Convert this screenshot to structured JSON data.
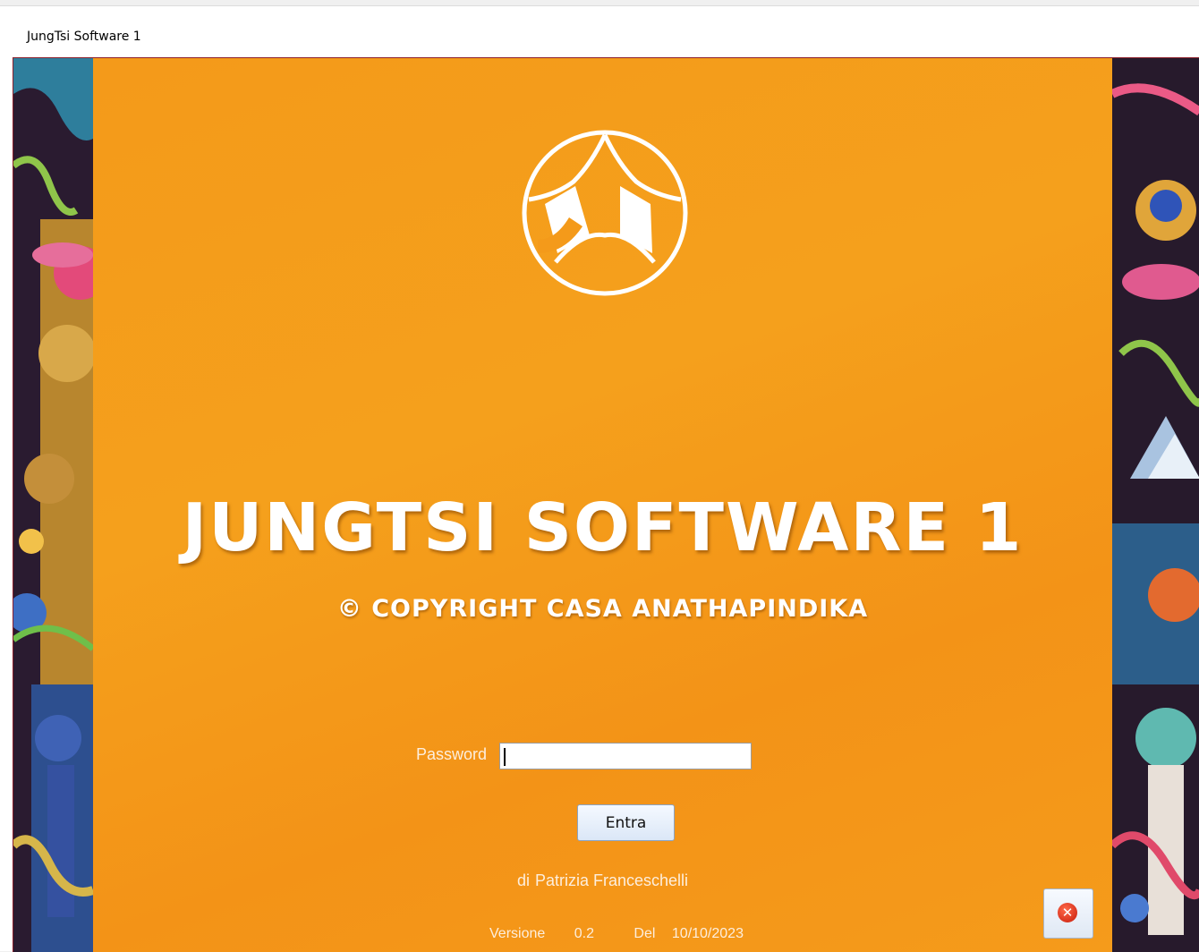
{
  "window": {
    "title": "JungTsi Software 1"
  },
  "splash": {
    "app_title": "JUNGTSI SOFTWARE 1",
    "copyright": "© COPYRIGHT CASA ANATHAPINDIKA"
  },
  "login": {
    "password_label": "Password",
    "password_value": "",
    "enter_button": "Entra"
  },
  "footer": {
    "author_prefix": "di",
    "author_name": "Patrizia Franceschelli",
    "version_label": "Versione",
    "version_value": "0.2",
    "date_label": "Del",
    "date_value": "10/10/2023"
  },
  "icons": {
    "logo": "prayer-flags-logo-icon",
    "close": "close-icon"
  },
  "colors": {
    "accent": "#f49a1a",
    "close": "#d9261c",
    "border": "#8b1f2b"
  }
}
